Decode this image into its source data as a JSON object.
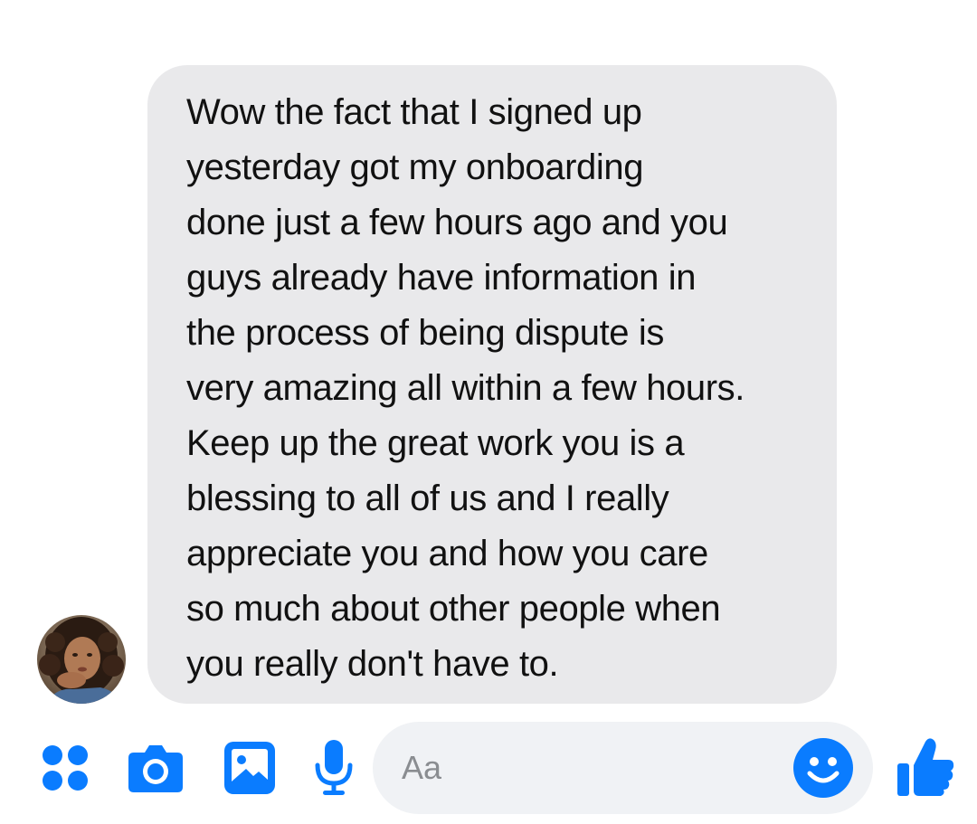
{
  "conversation": {
    "message": {
      "text": "Wow the fact that I signed up\nyesterday got my onboarding\ndone just a few hours ago and you\nguys already have information in\nthe process of being dispute is\nvery amazing all within a few hours.\nKeep up the great work you is a\nblessing to all of us and I really\nappreciate you and how you care\nso much about other people when\nyou really don't have to."
    },
    "sender": {
      "avatar_icon": "profile-photo"
    }
  },
  "composer": {
    "placeholder": "Aa",
    "icons": {
      "more": "four-dots-icon",
      "camera": "camera-icon",
      "gallery": "image-icon",
      "voice": "microphone-icon",
      "emoji": "smiley-icon",
      "like": "thumbs-up-icon"
    }
  },
  "colors": {
    "accent": "#0a7cff",
    "bubble": "#e9e9eb",
    "input_bg": "#f0f2f5",
    "text": "#111111",
    "placeholder": "#8a8d91"
  }
}
